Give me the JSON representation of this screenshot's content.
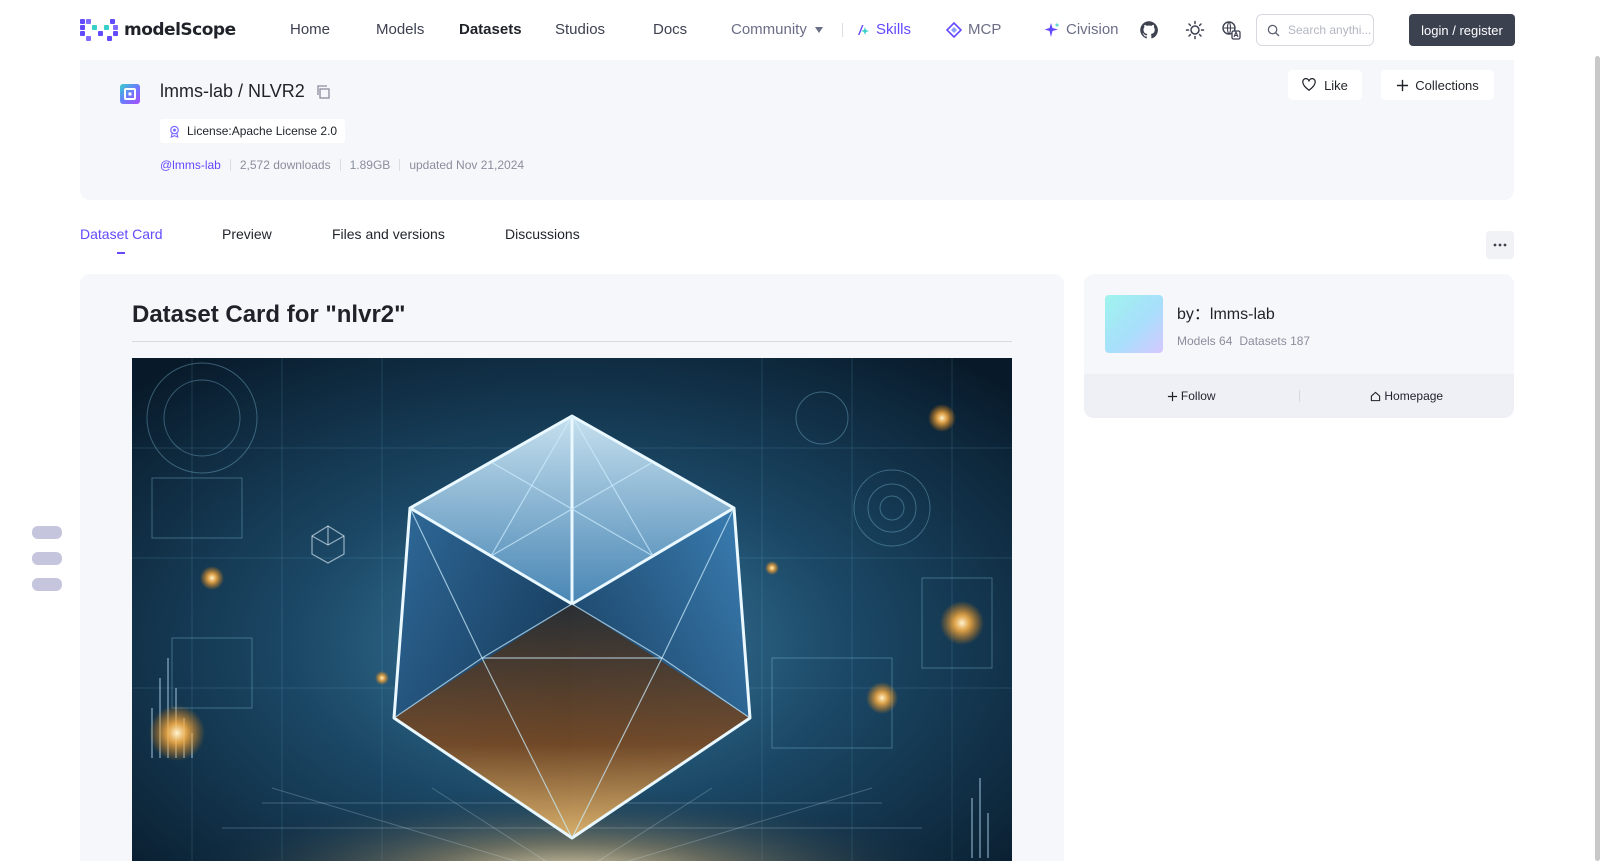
{
  "brand": {
    "name": "modelScope"
  },
  "nav": {
    "items": [
      "Home",
      "Models",
      "Datasets",
      "Studios",
      "Docs"
    ],
    "community": "Community",
    "skills": "Skills",
    "mcp": "MCP",
    "civision": "Civision"
  },
  "search": {
    "placeholder": "Search anythi..."
  },
  "auth": {
    "login_label": "login / register"
  },
  "dataset": {
    "owner": "lmms-lab",
    "name": "NLVR2",
    "license": "License:Apache License 2.0",
    "author_tag": "@lmms-lab",
    "downloads": "2,572 downloads",
    "size": "1.89GB",
    "updated": "updated Nov 21,2024"
  },
  "actions": {
    "like": "Like",
    "collections": "Collections"
  },
  "tabs": [
    "Dataset Card",
    "Preview",
    "Files and versions",
    "Discussions"
  ],
  "card": {
    "title": "Dataset Card for \"nlvr2\""
  },
  "author_panel": {
    "by": "by：lmms-lab",
    "models": "Models 64",
    "datasets": "Datasets 187",
    "follow": "Follow",
    "homepage": "Homepage"
  },
  "colors": {
    "accent": "#624aff",
    "dark_button": "#3c4150",
    "panel_bg": "#f6f7fb"
  },
  "icons": [
    "github-icon",
    "theme-toggle-icon",
    "translate-icon",
    "search-icon",
    "heart-icon",
    "plus-icon",
    "copy-icon",
    "license-badge-icon",
    "home-icon",
    "more-icon",
    "sparkle-icon",
    "mcp-icon",
    "skills-icon"
  ]
}
